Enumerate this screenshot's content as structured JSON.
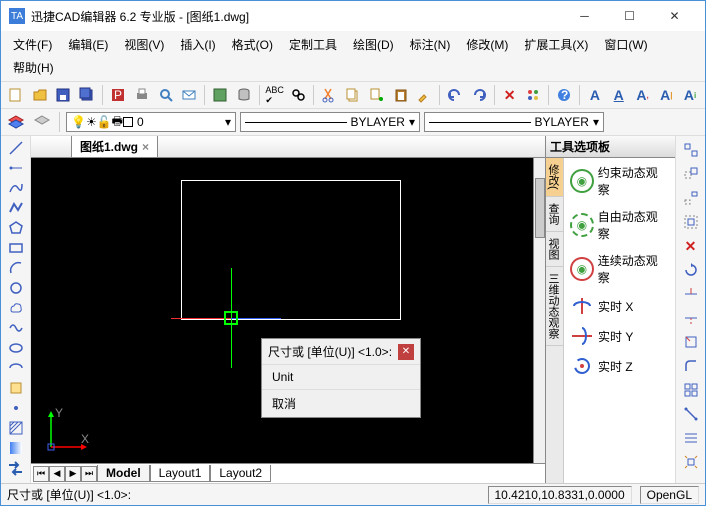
{
  "title": "迅捷CAD编辑器 6.2 专业版  - [图纸1.dwg]",
  "menu": [
    "文件(F)",
    "编辑(E)",
    "视图(V)",
    "插入(I)",
    "格式(O)",
    "定制工具",
    "绘图(D)",
    "标注(N)",
    "修改(M)",
    "扩展工具(X)",
    "窗口(W)",
    "帮助(H)"
  ],
  "doc_tab": "图纸1.dwg",
  "layer_combo": "0",
  "linetype": "BYLAYER",
  "lineweight": "BYLAYER",
  "context": {
    "title": "尺寸或 [单位(U)] <1.0>:",
    "items": [
      "Unit",
      "取消"
    ]
  },
  "bottom_tabs": [
    "Model",
    "Layout1",
    "Layout2"
  ],
  "palette": {
    "title": "工具选项板",
    "side": [
      "修改(",
      "查询",
      "视图",
      "三维动态观察"
    ],
    "items": [
      "约束动态观察",
      "自由动态观察",
      "连续动态观察",
      "实时 X",
      "实时 Y",
      "实时 Z"
    ]
  },
  "status": {
    "prompt": "尺寸或 [单位(U)] <1.0>:",
    "coords": "10.4210,10.8331,0.0000",
    "mode": "OpenGL"
  }
}
